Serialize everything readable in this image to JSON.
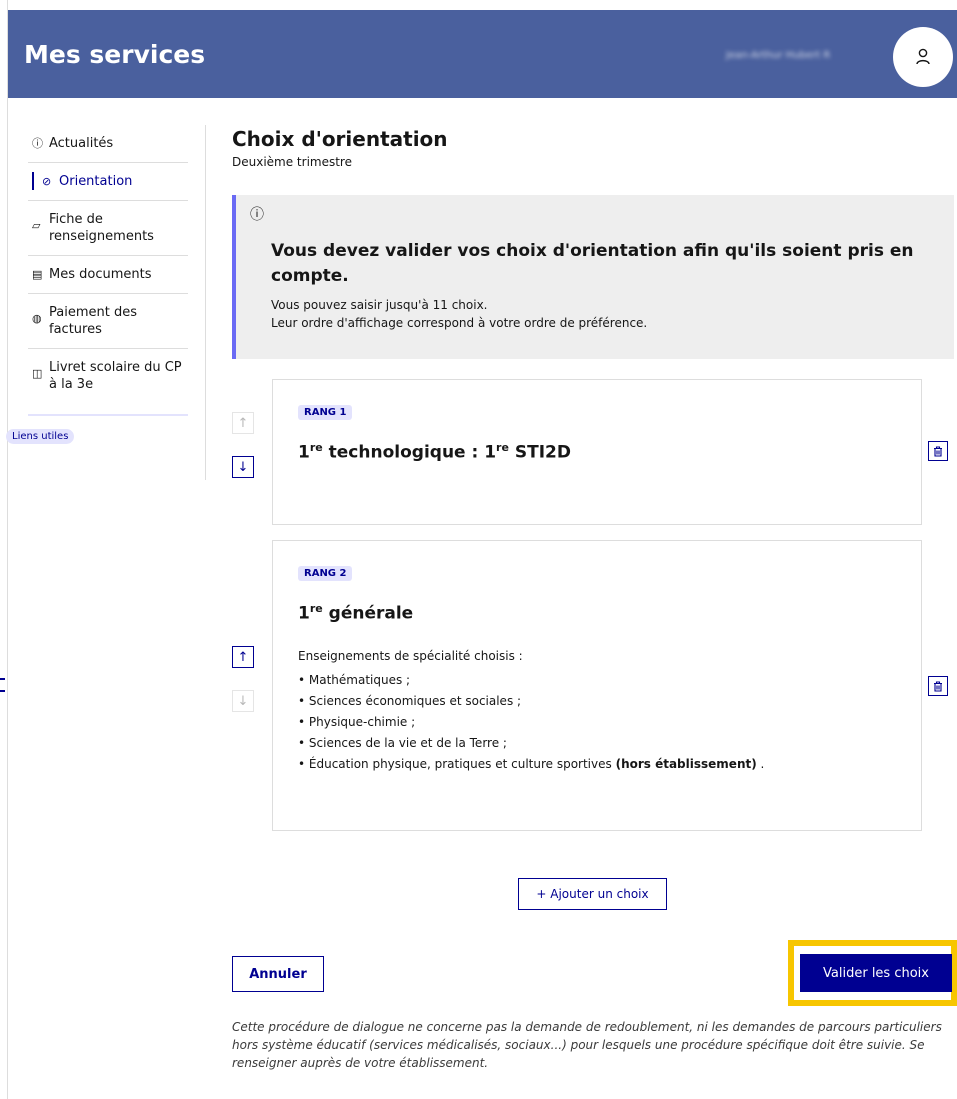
{
  "header": {
    "title": "Mes services",
    "username": "Jean-Arthur Hubert R"
  },
  "sidebar": {
    "items": [
      {
        "label": "Actualités",
        "icon": "info-icon",
        "active": false
      },
      {
        "label": "Orientation",
        "icon": "compass-icon",
        "active": true
      },
      {
        "label": "Fiche de renseignements",
        "icon": "file-icon",
        "active": false
      },
      {
        "label": "Mes documents",
        "icon": "documents-icon",
        "active": false
      },
      {
        "label": "Paiement des factures",
        "icon": "payment-icon",
        "active": false
      },
      {
        "label": "Livret scolaire du CP à la 3e",
        "icon": "book-icon",
        "active": false
      }
    ],
    "tag": "Liens utiles"
  },
  "main": {
    "title": "Choix d'orientation",
    "subtitle": "Deuxième trimestre",
    "alert": {
      "title": "Vous devez valider vos choix d'orientation afin qu'ils soient pris en compte.",
      "line1": "Vous pouvez saisir jusqu'à 11 choix.",
      "line2": "Leur ordre d'affichage correspond à votre ordre de préférence."
    },
    "choices": [
      {
        "rank": "RANG 1",
        "title_a": "1",
        "title_sup_a": "re",
        "title_b": " technologique : 1",
        "title_sup_b": "re",
        "title_c": " STI2D"
      },
      {
        "rank": "RANG 2",
        "title_a": "1",
        "title_sup_a": "re",
        "title_b": " générale",
        "spec_label": "Enseignements de spécialité choisis :",
        "specialties": [
          "• Mathématiques ;",
          "• Sciences économiques et sociales ;",
          "• Physique-chimie ;",
          "• Sciences de la vie et de la Terre ;"
        ],
        "last_specialty": "• Éducation physique, pratiques et culture sportives",
        "last_specialty_bold": "(hors établissement)",
        "last_specialty_end": " ."
      }
    ],
    "add_button": "+ Ajouter un choix",
    "cancel_button": "Annuler",
    "validate_button": "Valider les choix",
    "disclaimer": "Cette procédure de dialogue ne concerne pas la demande de redoublement, ni les demandes de parcours particuliers hors système éducatif (services médicalisés, sociaux...) pour lesquels une procédure spécifique doit être suivie. Se renseigner auprès de votre établissement."
  },
  "colors": {
    "header": "#4a609e",
    "primary": "#000091",
    "highlight": "#f7c600",
    "alert_border": "#6a6af4"
  }
}
